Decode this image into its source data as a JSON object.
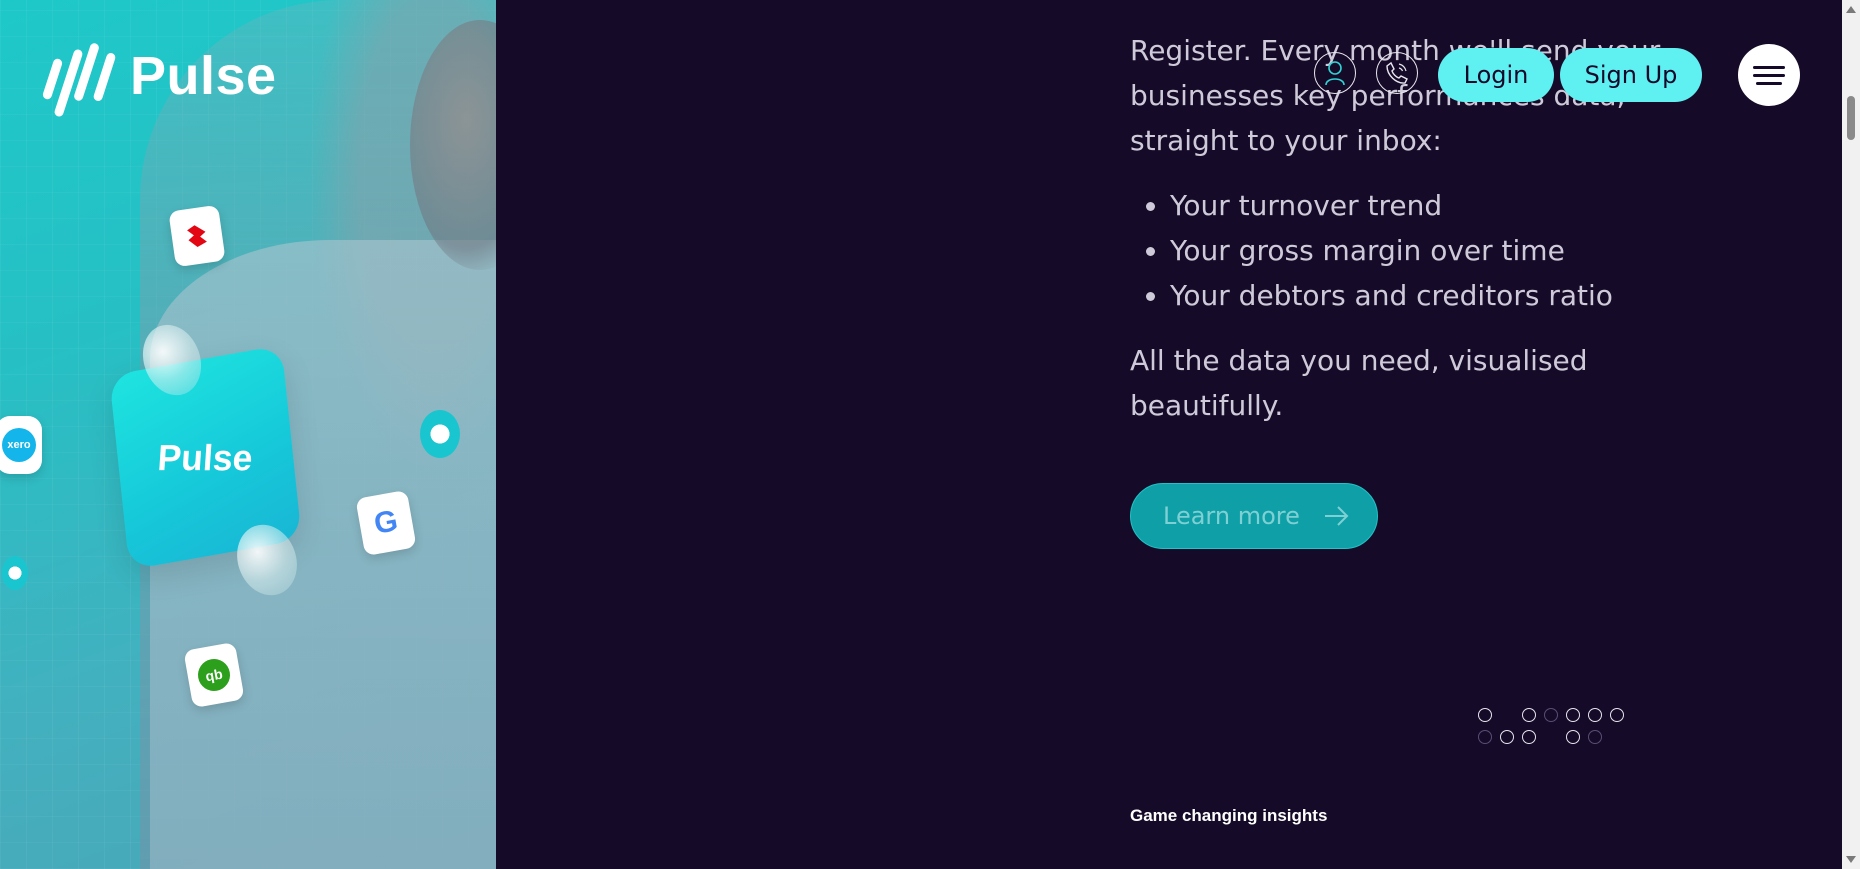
{
  "brand": {
    "name": "Pulse",
    "card_label": "Pulse"
  },
  "hero_icons": {
    "santander": "santander-icon",
    "xero": "xero",
    "google": "G",
    "quickbooks": "qb"
  },
  "content": {
    "intro": "Register. Every month we'll send your businesses key performances data, straight to your inbox:",
    "bullets": [
      "Your turnover trend",
      "Your gross margin over time",
      "Your debtors and creditors ratio"
    ],
    "outro": "All the data you need, visualised beautifully."
  },
  "cta": {
    "label": "Learn more"
  },
  "header": {
    "account_icon": "user-icon",
    "phone_icon": "phone-icon",
    "login_label": "Login",
    "signup_label": "Sign Up",
    "menu_icon": "hamburger-menu-icon"
  },
  "footer": {
    "label": "Game changing insights"
  },
  "colors": {
    "background": "#150b28",
    "accent": "#5ff0f2",
    "cta": "#0ea0a6",
    "hero": "#26c0c4"
  }
}
